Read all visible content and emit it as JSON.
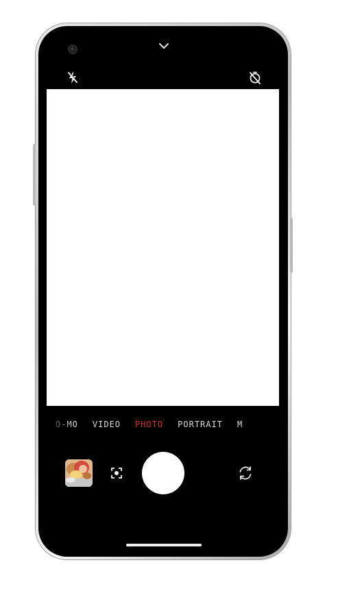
{
  "camera": {
    "modes": [
      "O-MO",
      "VIDEO",
      "PHOTO",
      "PORTRAIT",
      "M"
    ],
    "active_mode": "PHOTO",
    "icons": {
      "top_left": "flash-off-icon",
      "top_right": "timer-off-icon",
      "top_center": "chevron-down-icon",
      "bottom_left": "gallery-thumbnail",
      "bottom_middle_left": "lens-focus-icon",
      "bottom_center": "shutter-button",
      "bottom_right": "switch-camera-icon"
    },
    "colors": {
      "active_mode": "#d6302f",
      "inactive_mode": "#d9d9d9",
      "background": "#000000",
      "viewfinder": "#ffffff"
    }
  }
}
